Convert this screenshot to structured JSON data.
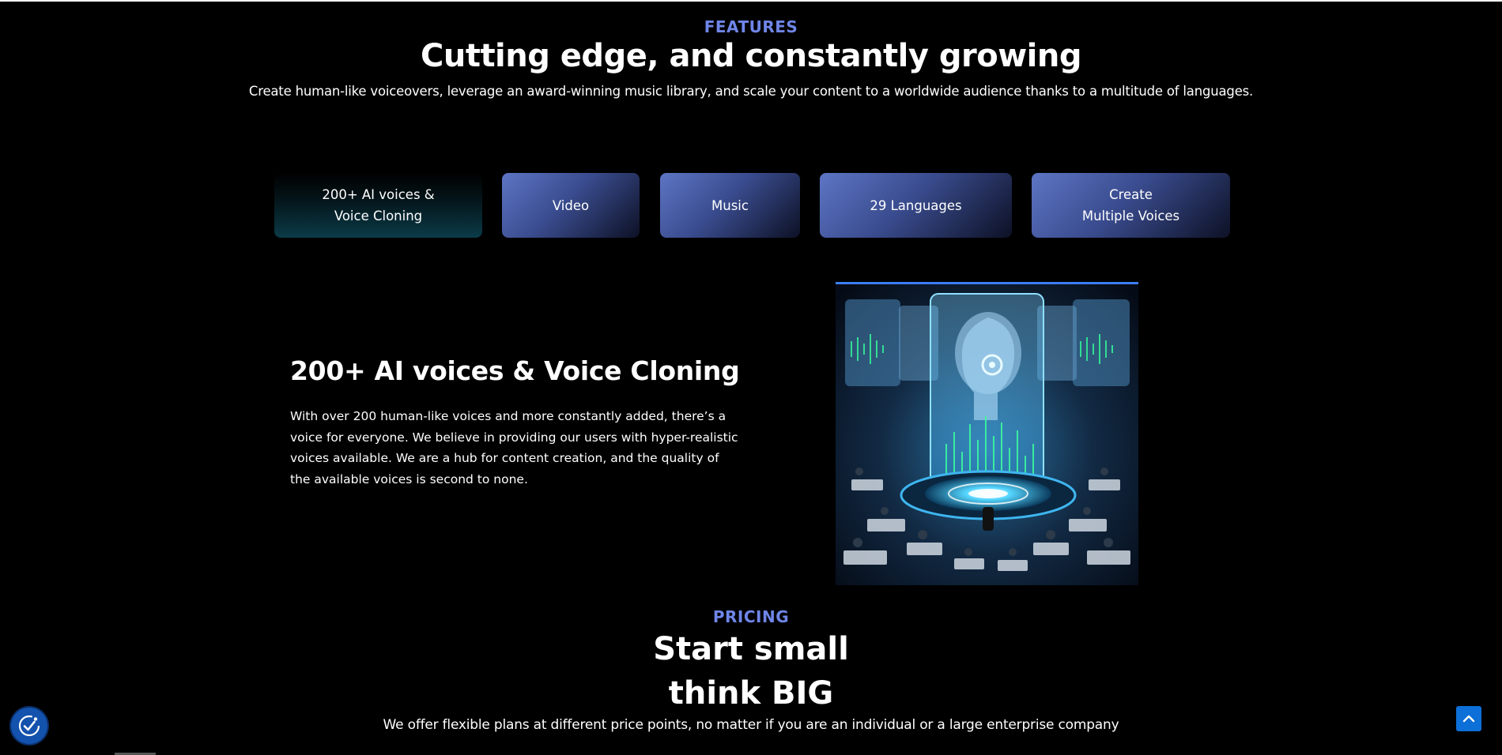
{
  "colors": {
    "accent": "#6f86e8",
    "background": "#000000",
    "tab_gradient_start": "#5d75c4",
    "active_tab": "#0b3b48",
    "scroll_top": "#0d6fd8",
    "accessibility": "#1352ad"
  },
  "features": {
    "eyebrow": "FEATURES",
    "title": "Cutting edge, and constantly growing",
    "subtitle": "Create human-like voiceovers, leverage an award-winning music library, and scale your content to a worldwide audience thanks to a multitude of languages.",
    "tabs": [
      {
        "label": "200+ AI voices &\nVoice Cloning",
        "active": true
      },
      {
        "label": "Video",
        "active": false
      },
      {
        "label": "Music",
        "active": false
      },
      {
        "label": "29 Languages",
        "active": false
      },
      {
        "label": "Create\nMultiple Voices",
        "active": false
      }
    ],
    "detail": {
      "title": "200+ AI voices & Voice Cloning",
      "body": "With over 200 human-like voices and more constantly added, there’s a voice for everyone. We believe in providing our users with hyper-realistic voices available. We are a hub for content creation, and the quality of the available voices is second to none.",
      "image_alt": "AI voice cloning control room illustration"
    }
  },
  "pricing": {
    "eyebrow": "PRICING",
    "title_line1": "Start small",
    "title_line2": "think BIG",
    "subtitle": "We offer flexible plans at different price points, no matter if you are an individual or a large enterprise company"
  },
  "widgets": {
    "accessibility_icon": "accessibility-check-icon",
    "scroll_top_icon": "chevron-up-icon"
  }
}
